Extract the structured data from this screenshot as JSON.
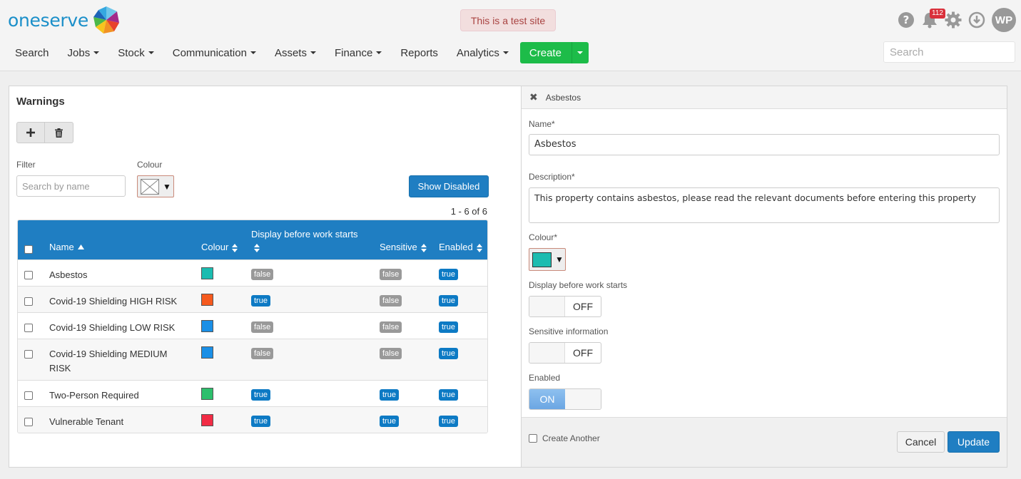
{
  "brand": {
    "name": "oneserve"
  },
  "test_notice": "This is a test site",
  "notifications": {
    "count": "112"
  },
  "user": {
    "initials": "WP"
  },
  "nav": {
    "items": [
      {
        "label": "Search",
        "dropdown": false
      },
      {
        "label": "Jobs",
        "dropdown": true
      },
      {
        "label": "Stock",
        "dropdown": true
      },
      {
        "label": "Communication",
        "dropdown": true
      },
      {
        "label": "Assets",
        "dropdown": true
      },
      {
        "label": "Finance",
        "dropdown": true
      },
      {
        "label": "Reports",
        "dropdown": false
      },
      {
        "label": "Analytics",
        "dropdown": true
      }
    ],
    "create_label": "Create",
    "search_placeholder": "Search"
  },
  "warnings": {
    "title": "Warnings",
    "filter_label": "Filter",
    "filter_placeholder": "Search by name",
    "colour_label": "Colour",
    "show_disabled_label": "Show Disabled",
    "pager": "1 - 6 of 6",
    "columns": {
      "name": "Name",
      "colour": "Colour",
      "display": "Display before work starts",
      "sensitive": "Sensitive",
      "enabled": "Enabled"
    },
    "rows": [
      {
        "name": "Asbestos",
        "colour": "#1bbcb0",
        "display": "false",
        "sensitive": "false",
        "enabled": "true"
      },
      {
        "name": "Covid-19 Shielding HIGH RISK",
        "colour": "#f65a1e",
        "display": "true",
        "sensitive": "false",
        "enabled": "true"
      },
      {
        "name": "Covid-19 Shielding LOW RISK",
        "colour": "#1a8fe6",
        "display": "false",
        "sensitive": "false",
        "enabled": "true"
      },
      {
        "name": "Covid-19 Shielding MEDIUM RISK",
        "colour": "#1a8fe6",
        "display": "false",
        "sensitive": "false",
        "enabled": "true"
      },
      {
        "name": "Two-Person Required",
        "colour": "#2dbf6c",
        "display": "true",
        "sensitive": "true",
        "enabled": "true"
      },
      {
        "name": "Vulnerable Tenant",
        "colour": "#f22c45",
        "display": "true",
        "sensitive": "true",
        "enabled": "true"
      }
    ]
  },
  "editor": {
    "header_title": "Asbestos",
    "name_label": "Name*",
    "name_value": "Asbestos",
    "description_label": "Description*",
    "description_value": "This property contains asbestos, please read the relevant documents before entering this property",
    "colour_label": "Colour*",
    "colour_value": "#1bbcb0",
    "display_label": "Display before work starts",
    "display_state": "OFF",
    "sensitive_label": "Sensitive information",
    "sensitive_state": "OFF",
    "enabled_label": "Enabled",
    "enabled_state": "ON",
    "create_another_label": "Create Another",
    "cancel_label": "Cancel",
    "update_label": "Update"
  }
}
